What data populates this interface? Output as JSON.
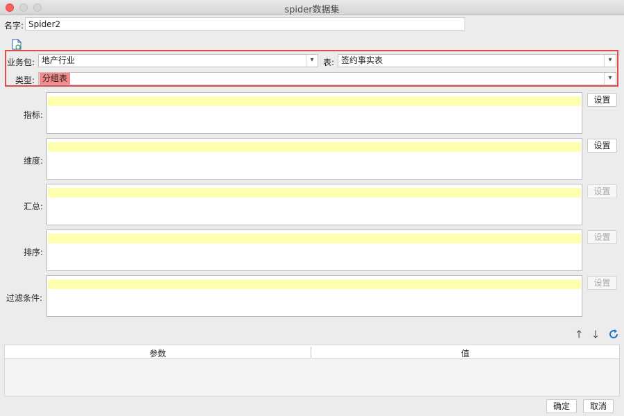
{
  "window": {
    "title": "spider数据集"
  },
  "name_field": {
    "label": "名字:",
    "value": "Spider2"
  },
  "toolbar": {
    "new_icon": "new-file-icon"
  },
  "business_package": {
    "label": "业务包:",
    "value": "地产行业"
  },
  "table_select": {
    "label": "表:",
    "value": "签约事实表"
  },
  "type_select": {
    "label": "类型:",
    "value": "分组表"
  },
  "fields": [
    {
      "label": "指标:",
      "button": "设置",
      "enabled": true
    },
    {
      "label": "维度:",
      "button": "设置",
      "enabled": true
    },
    {
      "label": "汇总:",
      "button": "设置",
      "enabled": false
    },
    {
      "label": "排序:",
      "button": "设置",
      "enabled": false
    },
    {
      "label": "过滤条件:",
      "button": "设置",
      "enabled": false
    }
  ],
  "param_toolbar": {
    "up_icon": "arrow-up-icon",
    "down_icon": "arrow-down-icon",
    "refresh_icon": "refresh-icon"
  },
  "param_table": {
    "columns": [
      "参数",
      "值"
    ],
    "rows": []
  },
  "footer": {
    "ok_label": "确定",
    "cancel_label": "取消"
  },
  "colors": {
    "accent_border": "#e24a4a",
    "type_tag": "#f48a8a",
    "field_strip": "#ffffb0",
    "refresh": "#1a73c9"
  }
}
